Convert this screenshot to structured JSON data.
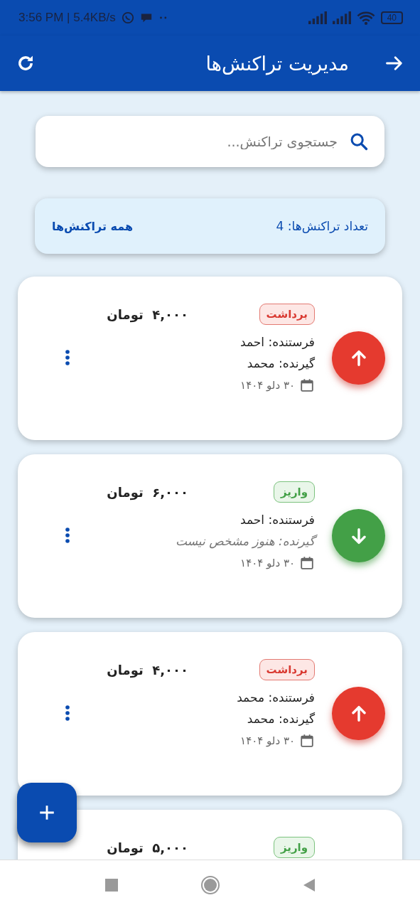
{
  "status_bar": {
    "time": "3:56 PM | 5.4KB/s",
    "battery": "40"
  },
  "app_bar": {
    "title": "مدیریت تراکنش‌ها"
  },
  "search": {
    "placeholder": "جستجوی تراکنش..."
  },
  "summary": {
    "count_label": "تعداد تراکنش‌ها: 4",
    "filter": "همه تراکنش‌ها"
  },
  "transactions": [
    {
      "kind": "withdraw",
      "type_label": "برداشت",
      "amount": "۴,۰۰۰  تومان",
      "sender": "فرستنده: احمد",
      "receiver": "گیرنده: محمد",
      "receiver_pending": false,
      "date": "۳۰ دلو ۱۴۰۴"
    },
    {
      "kind": "deposit",
      "type_label": "واریز",
      "amount": "۶,۰۰۰  تومان",
      "sender": "فرستنده: احمد",
      "receiver": "گیرنده: هنوز مشخص نیست",
      "receiver_pending": true,
      "date": "۳۰ دلو ۱۴۰۴"
    },
    {
      "kind": "withdraw",
      "type_label": "برداشت",
      "amount": "۴,۰۰۰  تومان",
      "sender": "فرستنده: محمد",
      "receiver": "گیرنده: محمد",
      "receiver_pending": false,
      "date": "۳۰ دلو ۱۴۰۴"
    },
    {
      "kind": "deposit",
      "type_label": "واریز",
      "amount": "۵,۰۰۰  تومان"
    }
  ]
}
